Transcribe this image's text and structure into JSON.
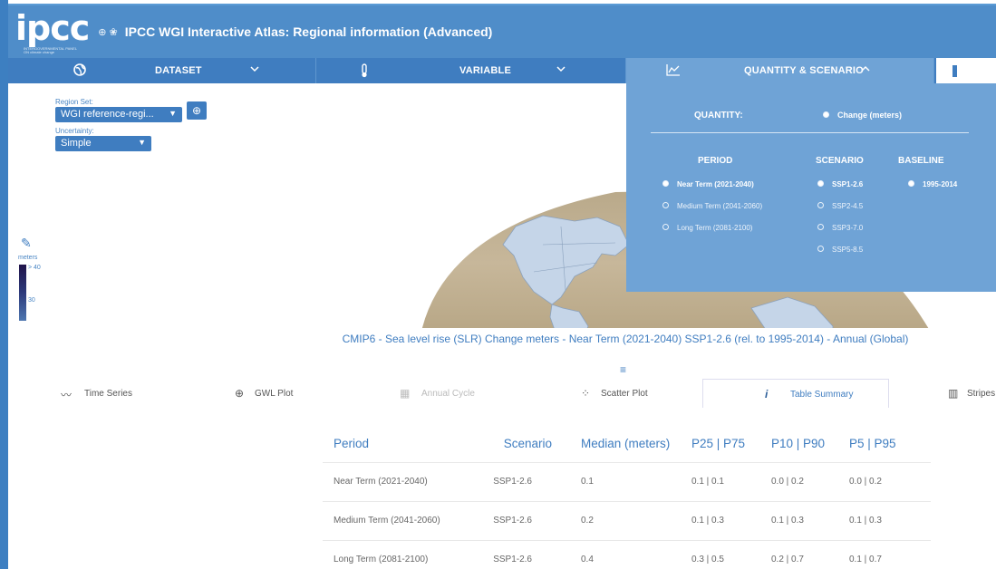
{
  "header": {
    "logo": "ipcc",
    "logo_sub": "INTERGOVERNMENTAL PANEL ON climate change",
    "title": "IPCC WGI Interactive Atlas: Regional information (Advanced)"
  },
  "nav": {
    "dataset": {
      "label": "DATASET",
      "icon": "globe-icon"
    },
    "variable": {
      "label": "VARIABLE",
      "icon": "thermometer-icon"
    },
    "quantity": {
      "label": "QUANTITY & SCENARIO",
      "icon": "line-chart-icon"
    }
  },
  "controls": {
    "region_set_label": "Region Set:",
    "region_set_value": "WGI reference-regi...",
    "uncertainty_label": "Uncertainty:",
    "uncertainty_value": "Simple"
  },
  "legend": {
    "unit": "meters",
    "top_tick": "> 40",
    "mid_tick": "30"
  },
  "panel": {
    "quantity_label": "QUANTITY:",
    "quantity_value": "Change (meters)",
    "period_header": "PERIOD",
    "scenario_header": "SCENARIO",
    "baseline_header": "BASELINE",
    "periods": [
      "Near Term (2021-2040)",
      "Medium Term (2041-2060)",
      "Long Term (2081-2100)"
    ],
    "scenarios": [
      "SSP1-2.6",
      "SSP2-4.5",
      "SSP3-7.0",
      "SSP5-8.5"
    ],
    "baseline": "1995-2014"
  },
  "caption": "CMIP6 - Sea level rise (SLR) Change meters - Near Term (2021-2040) SSP1-2.6 (rel. to 1995-2014) - Annual (Global)",
  "tabs": [
    "Time Series",
    "GWL Plot",
    "Annual Cycle",
    "Scatter Plot",
    "Table Summary",
    "Stripes"
  ],
  "table": {
    "headers": [
      "Period",
      "Scenario",
      "Median (meters)",
      "P25 | P75",
      "P10 | P90",
      "P5 | P95"
    ],
    "rows": [
      [
        "Near Term (2021-2040)",
        "SSP1-2.6",
        "0.1",
        "0.1 | 0.1",
        "0.0 | 0.2",
        "0.0 | 0.2"
      ],
      [
        "Medium Term (2041-2060)",
        "SSP1-2.6",
        "0.2",
        "0.1 | 0.3",
        "0.1 | 0.3",
        "0.1 | 0.3"
      ],
      [
        "Long Term (2081-2100)",
        "SSP1-2.6",
        "0.4",
        "0.3 | 0.5",
        "0.2 | 0.7",
        "0.1 | 0.7"
      ]
    ]
  },
  "colors": {
    "brand_blue": "#3f7dc0",
    "panel_blue": "#6fa3d6"
  }
}
